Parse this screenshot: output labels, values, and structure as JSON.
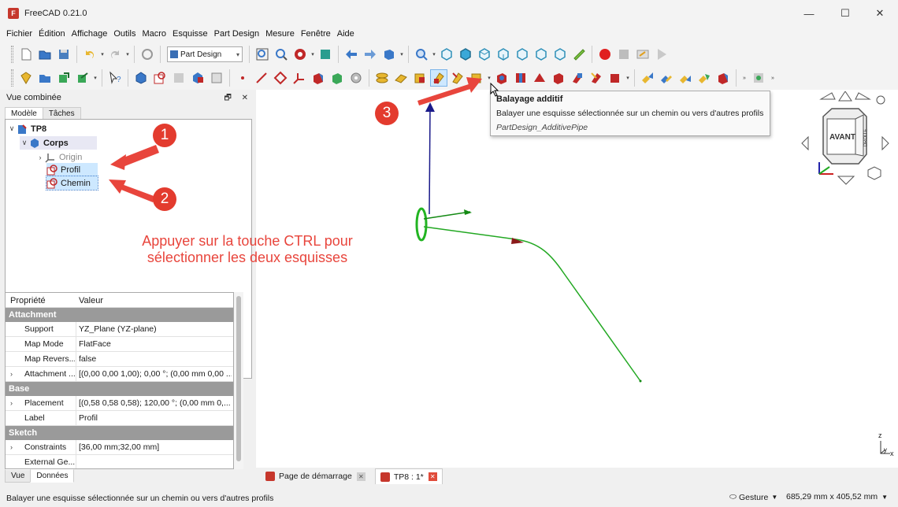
{
  "window": {
    "title": "FreeCAD 0.21.0",
    "minimize": "—",
    "maximize": "☐",
    "close": "✕"
  },
  "menu": [
    "Fichier",
    "Édition",
    "Affichage",
    "Outils",
    "Macro",
    "Esquisse",
    "Part Design",
    "Mesure",
    "Fenêtre",
    "Aide"
  ],
  "toolbar": {
    "workbench": "Part Design"
  },
  "panel": {
    "title": "Vue combinée",
    "float_btn": "🗗",
    "close_btn": "✕",
    "tabs": [
      "Modèle",
      "Tâches"
    ],
    "tree": {
      "doc": "TP8",
      "body": "Corps",
      "origin": "Origin",
      "sketch1": "Profil",
      "sketch2": "Chemin"
    },
    "bottom_tabs": [
      "Vue",
      "Données"
    ]
  },
  "properties": {
    "headers": [
      "Propriété",
      "Valeur"
    ],
    "groups": [
      {
        "label": "Attachment",
        "rows": [
          {
            "name": "Support",
            "value": "YZ_Plane (YZ-plane)",
            "expandable": false
          },
          {
            "name": "Map Mode",
            "value": "FlatFace",
            "expandable": false
          },
          {
            "name": "Map Revers...",
            "value": "false",
            "expandable": false
          },
          {
            "name": "Attachment ...",
            "value": "[(0,00 0,00 1,00); 0,00 °; (0,00 mm  0,00 ...",
            "expandable": true
          }
        ]
      },
      {
        "label": "Base",
        "rows": [
          {
            "name": "Placement",
            "value": "[(0,58 0,58 0,58); 120,00 °; (0,00 mm  0,...",
            "expandable": true
          },
          {
            "name": "Label",
            "value": "Profil",
            "expandable": false
          }
        ]
      },
      {
        "label": "Sketch",
        "rows": [
          {
            "name": "Constraints",
            "value": "[36,00 mm;32,00 mm]",
            "expandable": true
          },
          {
            "name": "External Ge...",
            "value": "",
            "expandable": false
          }
        ]
      }
    ]
  },
  "tooltip": {
    "title": "Balayage additif",
    "desc": "Balayer une esquisse sélectionnée sur un chemin ou vers d'autres profils",
    "command": "PartDesign_AdditivePipe"
  },
  "annotations": {
    "text_line1": "Appuyer sur la touche CTRL pour",
    "text_line2": "sélectionner les deux esquisses",
    "badge1": "1",
    "badge2": "2",
    "badge3": "3",
    "color": "#e8453c"
  },
  "navcube": {
    "front": "AVANT",
    "right": "DROITE"
  },
  "axis": {
    "z": "z",
    "y": "y",
    "x": "x"
  },
  "doc_tabs": [
    {
      "label": "Page de démarrage",
      "close": "✕"
    },
    {
      "label": "TP8 : 1*",
      "close": "✕"
    }
  ],
  "status": {
    "message": "Balayer une esquisse sélectionnée sur un chemin ou vers d'autres profils",
    "nav_style": "Gesture",
    "dimensions": "685,29 mm x 405,52 mm"
  }
}
